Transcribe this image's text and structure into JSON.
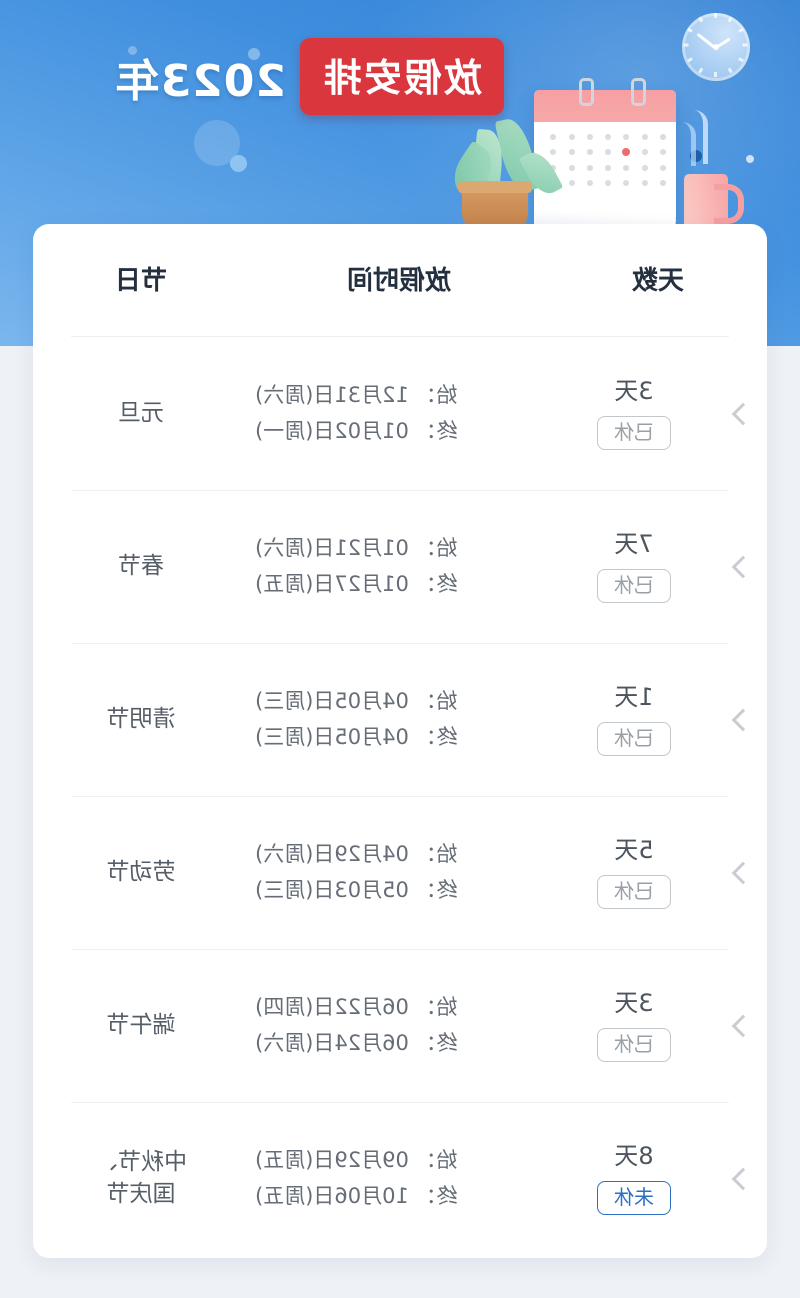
{
  "banner": {
    "title_year": "2023年",
    "title_badge": "放假安排",
    "icons": [
      "clock-icon",
      "mug-icon",
      "calendar-icon",
      "plant-icon"
    ]
  },
  "table": {
    "headers": {
      "holiday": "节日",
      "time": "放假时间",
      "days": "天数"
    },
    "labels": {
      "start": "始：",
      "end": "终："
    },
    "rows": [
      {
        "holiday": "元旦",
        "holiday_line2": "",
        "start": "始： 12月31日(周六)",
        "end": "终： 01月02日(周一)",
        "days": "3天",
        "status": "已休",
        "status_type": "done"
      },
      {
        "holiday": "春节",
        "holiday_line2": "",
        "start": "始： 01月21日(周六)",
        "end": "终： 01月27日(周五)",
        "days": "7天",
        "status": "已休",
        "status_type": "done"
      },
      {
        "holiday": "清明节",
        "holiday_line2": "",
        "start": "始： 04月05日(周三)",
        "end": "终： 04月05日(周三)",
        "days": "1天",
        "status": "已休",
        "status_type": "done"
      },
      {
        "holiday": "劳动节",
        "holiday_line2": "",
        "start": "始： 04月29日(周六)",
        "end": "终： 05月03日(周三)",
        "days": "5天",
        "status": "已休",
        "status_type": "done"
      },
      {
        "holiday": "端午节",
        "holiday_line2": "",
        "start": "始： 06月22日(周四)",
        "end": "终： 06月24日(周六)",
        "days": "3天",
        "status": "已休",
        "status_type": "done"
      },
      {
        "holiday": "中秋节、",
        "holiday_line2": "国庆节",
        "start": "始： 09月29日(周五)",
        "end": "终： 10月06日(周五)",
        "days": "8天",
        "status": "未休",
        "status_type": "pending"
      }
    ]
  },
  "colors": {
    "banner_blue": "#3f8ede",
    "badge_red": "#d9363e",
    "page_bg": "#eef1f6",
    "card_bg": "#ffffff",
    "status_done": "#9aa0a6",
    "status_pending": "#2c6fc4",
    "header_text": "#24303f"
  }
}
